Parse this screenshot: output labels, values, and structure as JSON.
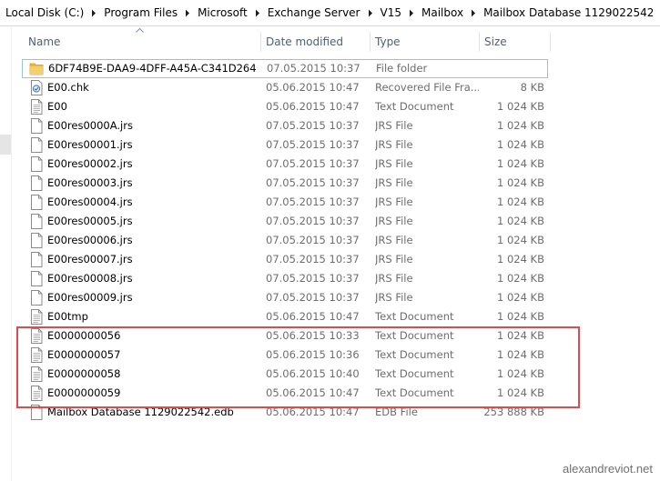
{
  "breadcrumb": [
    "Local Disk (C:)",
    "Program Files",
    "Microsoft",
    "Exchange Server",
    "V15",
    "Mailbox",
    "Mailbox Database 1129022542"
  ],
  "columns": {
    "name": "Name",
    "date": "Date modified",
    "type": "Type",
    "size": "Size"
  },
  "files": [
    {
      "name": "6DF74B9E-DAA9-4DFF-A45A-C341D2646...",
      "date": "07.05.2015 10:37",
      "type": "File folder",
      "size": "",
      "icon": "folder-icon"
    },
    {
      "name": "E00.chk",
      "date": "05.06.2015 10:47",
      "type": "Recovered File Fra...",
      "size": "8 KB",
      "icon": "chk-file-icon"
    },
    {
      "name": "E00",
      "date": "05.06.2015 10:47",
      "type": "Text Document",
      "size": "1 024 KB",
      "icon": "document-icon"
    },
    {
      "name": "E00res0000A.jrs",
      "date": "07.05.2015 10:37",
      "type": "JRS File",
      "size": "1 024 KB",
      "icon": "file-icon"
    },
    {
      "name": "E00res00001.jrs",
      "date": "07.05.2015 10:37",
      "type": "JRS File",
      "size": "1 024 KB",
      "icon": "file-icon"
    },
    {
      "name": "E00res00002.jrs",
      "date": "07.05.2015 10:37",
      "type": "JRS File",
      "size": "1 024 KB",
      "icon": "file-icon"
    },
    {
      "name": "E00res00003.jrs",
      "date": "07.05.2015 10:37",
      "type": "JRS File",
      "size": "1 024 KB",
      "icon": "file-icon"
    },
    {
      "name": "E00res00004.jrs",
      "date": "07.05.2015 10:37",
      "type": "JRS File",
      "size": "1 024 KB",
      "icon": "file-icon"
    },
    {
      "name": "E00res00005.jrs",
      "date": "07.05.2015 10:37",
      "type": "JRS File",
      "size": "1 024 KB",
      "icon": "file-icon"
    },
    {
      "name": "E00res00006.jrs",
      "date": "07.05.2015 10:37",
      "type": "JRS File",
      "size": "1 024 KB",
      "icon": "file-icon"
    },
    {
      "name": "E00res00007.jrs",
      "date": "07.05.2015 10:37",
      "type": "JRS File",
      "size": "1 024 KB",
      "icon": "file-icon"
    },
    {
      "name": "E00res00008.jrs",
      "date": "07.05.2015 10:37",
      "type": "JRS File",
      "size": "1 024 KB",
      "icon": "file-icon"
    },
    {
      "name": "E00res00009.jrs",
      "date": "07.05.2015 10:37",
      "type": "JRS File",
      "size": "1 024 KB",
      "icon": "file-icon"
    },
    {
      "name": "E00tmp",
      "date": "05.06.2015 10:47",
      "type": "Text Document",
      "size": "1 024 KB",
      "icon": "document-icon"
    },
    {
      "name": "E0000000056",
      "date": "05.06.2015 10:33",
      "type": "Text Document",
      "size": "1 024 KB",
      "icon": "document-icon"
    },
    {
      "name": "E0000000057",
      "date": "05.06.2015 10:36",
      "type": "Text Document",
      "size": "1 024 KB",
      "icon": "document-icon"
    },
    {
      "name": "E0000000058",
      "date": "05.06.2015 10:40",
      "type": "Text Document",
      "size": "1 024 KB",
      "icon": "document-icon"
    },
    {
      "name": "E0000000059",
      "date": "05.06.2015 10:47",
      "type": "Text Document",
      "size": "1 024 KB",
      "icon": "document-icon"
    },
    {
      "name": "Mailbox Database 1129022542.edb",
      "date": "05.06.2015 10:47",
      "type": "EDB File",
      "size": "253 888 KB",
      "icon": "file-icon"
    }
  ],
  "watermark": "alexandreviot.net",
  "colors": {
    "highlight": "#e04a4a",
    "header_text": "#4c607a",
    "focus_border": "#99c1e6"
  }
}
